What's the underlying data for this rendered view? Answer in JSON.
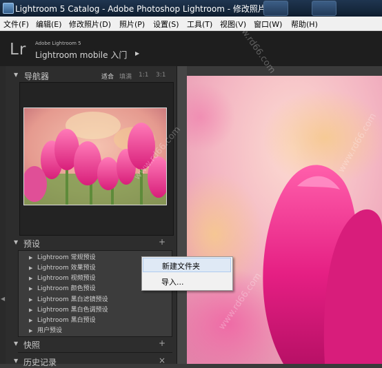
{
  "window": {
    "title": "Lightroom 5 Catalog - Adobe Photoshop Lightroom - 修改照片"
  },
  "menubar": {
    "items": [
      "文件(F)",
      "编辑(E)",
      "修改照片(D)",
      "照片(P)",
      "设置(S)",
      "工具(T)",
      "视图(V)",
      "窗口(W)",
      "帮助(H)"
    ]
  },
  "identity": {
    "logo": "Lr",
    "product_line": "Adobe Lightroom 5",
    "mobile_link": "Lightroom mobile 入门"
  },
  "navigator": {
    "title": "导航器",
    "options": [
      "适合",
      "填满",
      "1:1",
      "3:1"
    ],
    "selected": "适合"
  },
  "presets": {
    "title": "预设",
    "items": [
      "Lightroom 常规预设",
      "Lightroom 效果预设",
      "Lightroom 视频预设",
      "Lightroom 颜色预设",
      "Lightroom 黑白滤镜预设",
      "Lightroom 黑白色调预设",
      "Lightroom 黑白预设",
      "用户预设"
    ]
  },
  "snapshots": {
    "title": "快照"
  },
  "history": {
    "title": "历史记录"
  },
  "context_menu": {
    "items": [
      "新建文件夹",
      "导入..."
    ],
    "highlighted": "新建文件夹"
  },
  "watermark": {
    "text": "www.rd66.com"
  },
  "icons": {
    "panel_collapse": "triangle-down-icon",
    "preset_folder": "triangle-right-icon",
    "add": "plus-icon",
    "close": "close-icon"
  }
}
